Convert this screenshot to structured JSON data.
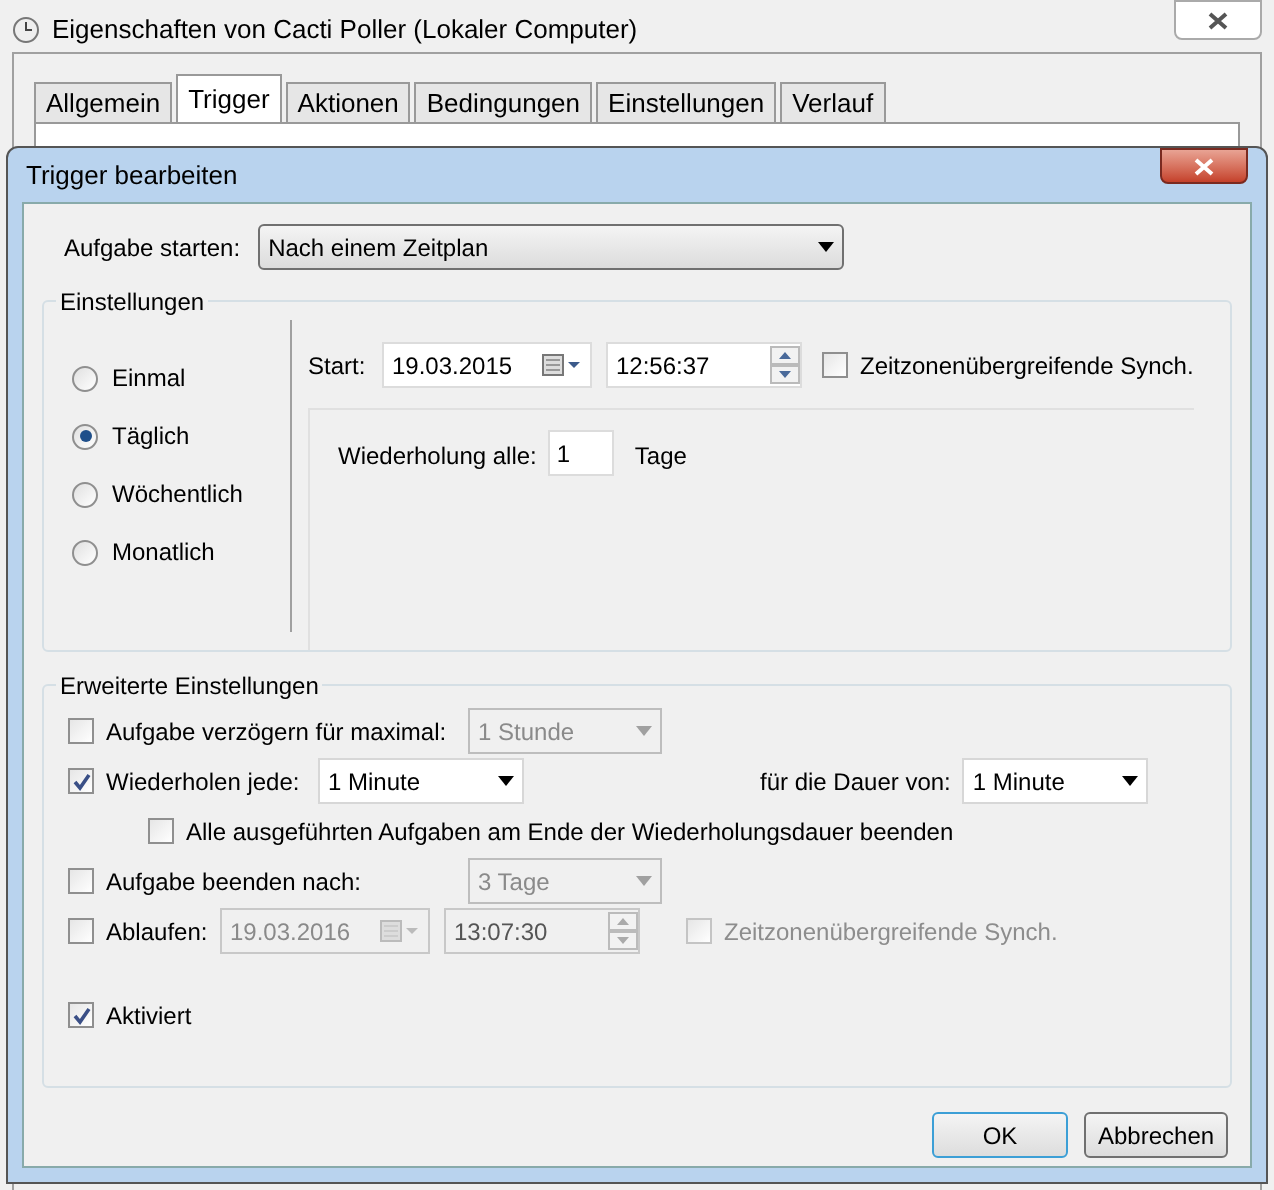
{
  "background_window": {
    "title": "Eigenschaften von Cacti Poller (Lokaler Computer)",
    "tabs": [
      {
        "label": "Allgemein",
        "selected": false
      },
      {
        "label": "Trigger",
        "selected": true
      },
      {
        "label": "Aktionen",
        "selected": false
      },
      {
        "label": "Bedingungen",
        "selected": false
      },
      {
        "label": "Einstellungen",
        "selected": false
      },
      {
        "label": "Verlauf",
        "selected": false
      }
    ]
  },
  "dialog": {
    "title": "Trigger bearbeiten",
    "start_task": {
      "label": "Aufgabe starten:",
      "value": "Nach einem Zeitplan"
    },
    "settings": {
      "title": "Einstellungen",
      "schedule": [
        {
          "label": "Einmal",
          "selected": false
        },
        {
          "label": "Täglich",
          "selected": true
        },
        {
          "label": "Wöchentlich",
          "selected": false
        },
        {
          "label": "Monatlich",
          "selected": false
        }
      ],
      "start": {
        "label": "Start:",
        "date": "19.03.2015",
        "time": "12:56:37",
        "sync": {
          "label": "Zeitzonenübergreifende Synch.",
          "checked": false
        }
      },
      "recur": {
        "label": "Wiederholung alle:",
        "value": "1",
        "unit": "Tage"
      }
    },
    "advanced": {
      "title": "Erweiterte Einstellungen",
      "delay": {
        "label": "Aufgabe verzögern für maximal:",
        "checked": false,
        "value": "1 Stunde"
      },
      "repeat": {
        "label": "Wiederholen jede:",
        "checked": true,
        "value": "1 Minute",
        "duration_label": "für die Dauer von:",
        "duration_value": "1 Minute"
      },
      "stop_all": {
        "label": "Alle ausgeführten Aufgaben am Ende der Wiederholungsdauer beenden",
        "checked": false
      },
      "stop_after": {
        "label": "Aufgabe beenden nach:",
        "checked": false,
        "value": "3 Tage"
      },
      "expire": {
        "label": "Ablaufen:",
        "checked": false,
        "date": "19.03.2016",
        "time": "13:07:30",
        "sync": {
          "label": "Zeitzonenübergreifende Synch.",
          "checked": false
        }
      },
      "enabled": {
        "label": "Aktiviert",
        "checked": true
      }
    },
    "buttons": [
      {
        "label": "OK",
        "default": true
      },
      {
        "label": "Abbrechen",
        "default": false
      }
    ]
  }
}
